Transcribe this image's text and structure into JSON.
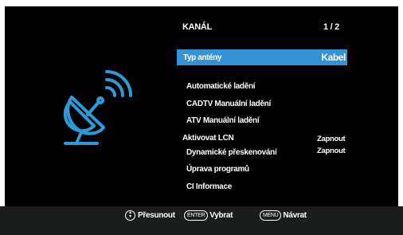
{
  "menu": {
    "title": "KANÁL",
    "page": "1 / 2",
    "selected": {
      "label": "Typ antény",
      "value": "Kabel"
    },
    "items": [
      {
        "label": "Automatické ladění"
      },
      {
        "label": "CADTV Manuální ladění"
      },
      {
        "label": "ATV Manuální ladění"
      },
      {
        "label": "Aktivovat LCN",
        "value": "Zapnout"
      },
      {
        "label": "Dynamické přeskenování",
        "value": "Zapnout"
      },
      {
        "label": "Úprava programů"
      },
      {
        "label": "CI Informace"
      }
    ]
  },
  "footer": {
    "move_label": "Přesunout",
    "enter_key": "ENTER",
    "select_label": "Vybrat",
    "menu_key": "MENU",
    "back_label": "Návrat"
  },
  "icon": "satellite-dish-icon",
  "colors": {
    "highlight": "#3592d4",
    "icon": "#2f9bd6",
    "background": "#000000",
    "footer": "#1b1c1c"
  }
}
